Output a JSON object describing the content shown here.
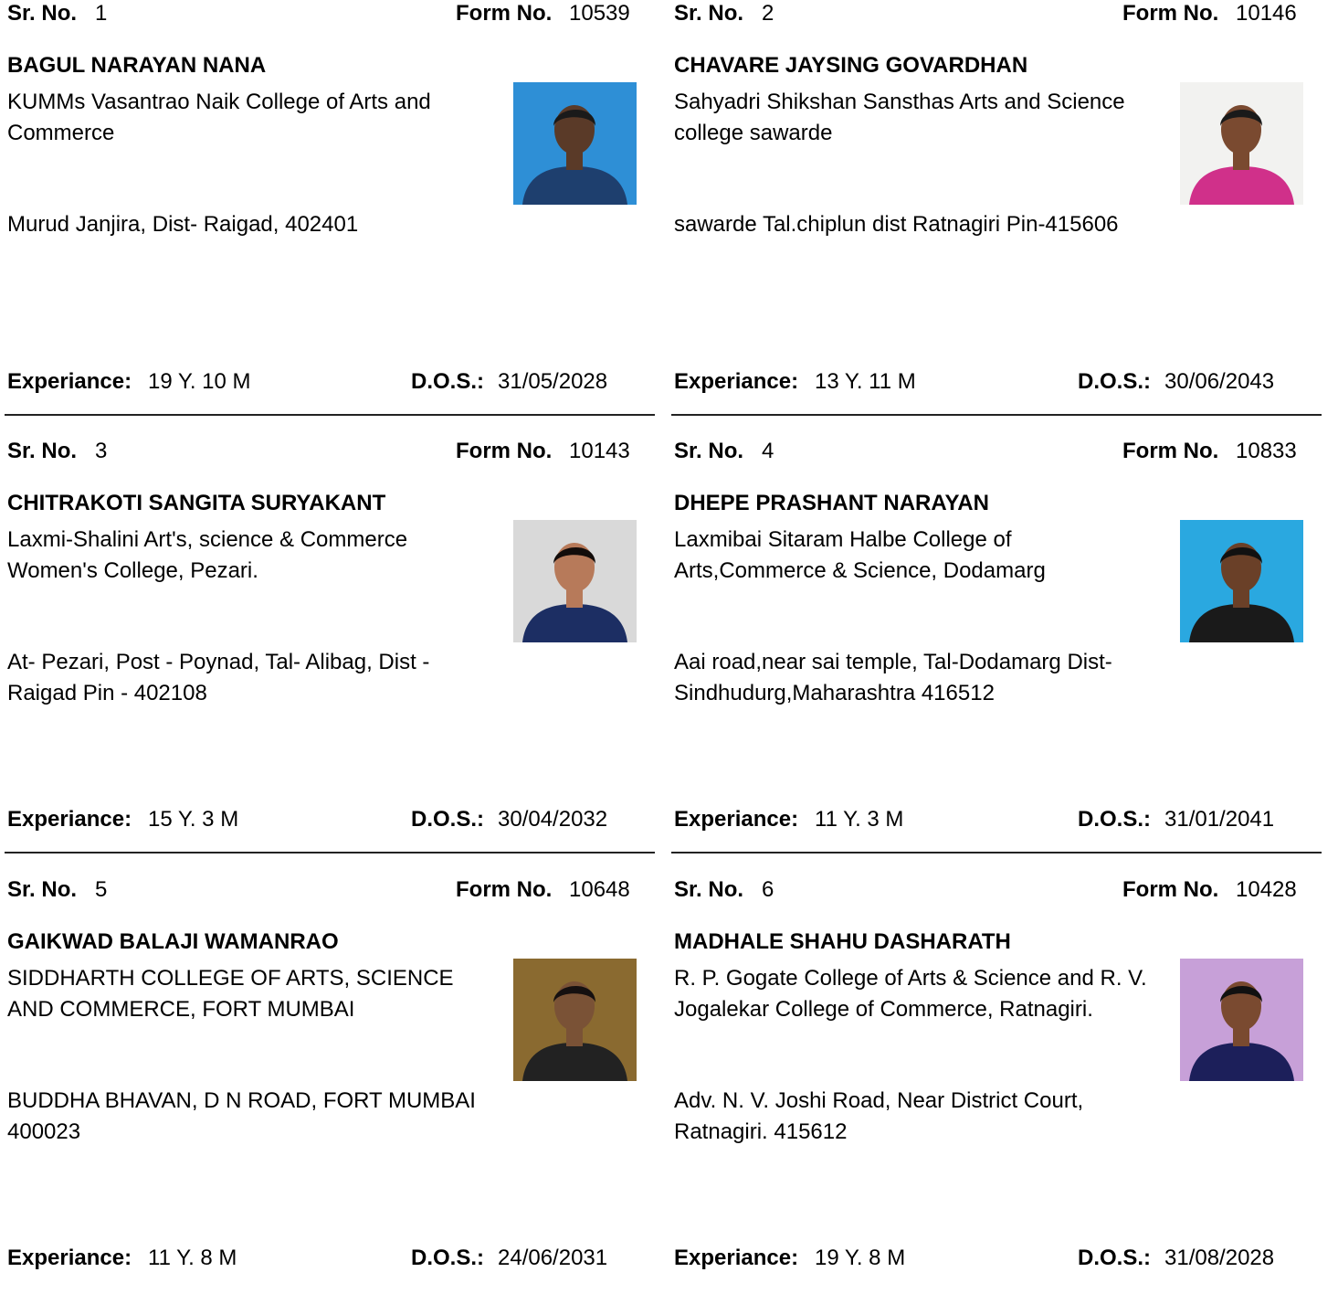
{
  "labels": {
    "sr_no": "Sr. No.",
    "form_no": "Form No.",
    "experience": "Experiance:",
    "dos": "D.O.S.:"
  },
  "entries": [
    {
      "sr_no": "1",
      "form_no": "10539",
      "name": "BAGUL NARAYAN NANA",
      "college": "KUMMs Vasantrao Naik College of Arts and Commerce",
      "address": "Murud Janjira, Dist- Raigad, 402401",
      "experience": "19 Y. 10 M",
      "dos": "31/05/2028",
      "photo": {
        "background": "#2e8fd6",
        "shirt": "#1e3f6e",
        "skin": "#5a3a28",
        "hair": "#1a1a1a"
      }
    },
    {
      "sr_no": "2",
      "form_no": "10146",
      "name": "CHAVARE JAYSING GOVARDHAN",
      "college": "Sahyadri Shikshan Sansthas Arts and Science college sawarde",
      "address": "sawarde Tal.chiplun dist Ratnagiri Pin-415606",
      "experience": "13 Y. 11 M",
      "dos": "30/06/2043",
      "photo": {
        "background": "#f2f2f0",
        "shirt": "#d0308a",
        "skin": "#7a4a30",
        "hair": "#1a1a1a"
      }
    },
    {
      "sr_no": "3",
      "form_no": "10143",
      "name": "CHITRAKOTI SANGITA SURYAKANT",
      "college": "Laxmi-Shalini Art's, science & Commerce Women's College, Pezari.",
      "address": "At- Pezari, Post - Poynad, Tal- Alibag, Dist - Raigad Pin - 402108",
      "experience": "15 Y. 3 M",
      "dos": "30/04/2032",
      "photo": {
        "background": "#d9d9d9",
        "shirt": "#1c2e63",
        "skin": "#b77a5a",
        "hair": "#120c0a"
      }
    },
    {
      "sr_no": "4",
      "form_no": "10833",
      "name": "DHEPE PRASHANT NARAYAN",
      "college": "Laxmibai Sitaram Halbe College of Arts,Commerce & Science, Dodamarg",
      "address": "Aai road,near sai temple, Tal-Dodamarg Dist-Sindhudurg,Maharashtra 416512",
      "experience": "11 Y. 3 M",
      "dos": "31/01/2041",
      "photo": {
        "background": "#2aa8e0",
        "shirt": "#1a1a1a",
        "skin": "#6a4028",
        "hair": "#111111"
      }
    },
    {
      "sr_no": "5",
      "form_no": "10648",
      "name": "GAIKWAD BALAJI WAMANRAO",
      "college": "SIDDHARTH COLLEGE OF ARTS, SCIENCE AND COMMERCE, FORT MUMBAI",
      "address": "BUDDHA BHAVAN, D N ROAD, FORT MUMBAI 400023",
      "experience": "11 Y. 8 M",
      "dos": "24/06/2031",
      "photo": {
        "background": "#8a6a30",
        "shirt": "#222222",
        "skin": "#7a5236",
        "hair": "#151010"
      }
    },
    {
      "sr_no": "6",
      "form_no": "10428",
      "name": "MADHALE SHAHU DASHARATH",
      "college": "R. P. Gogate College of Arts & Science and R. V. Jogalekar College of Commerce, Ratnagiri.",
      "address": "Adv. N. V. Joshi Road, Near District Court, Ratnagiri. 415612",
      "experience": "19 Y. 8 M",
      "dos": "31/08/2028",
      "photo": {
        "background": "#c7a0d8",
        "shirt": "#1c1f5a",
        "skin": "#7a4a30",
        "hair": "#111111"
      }
    }
  ]
}
